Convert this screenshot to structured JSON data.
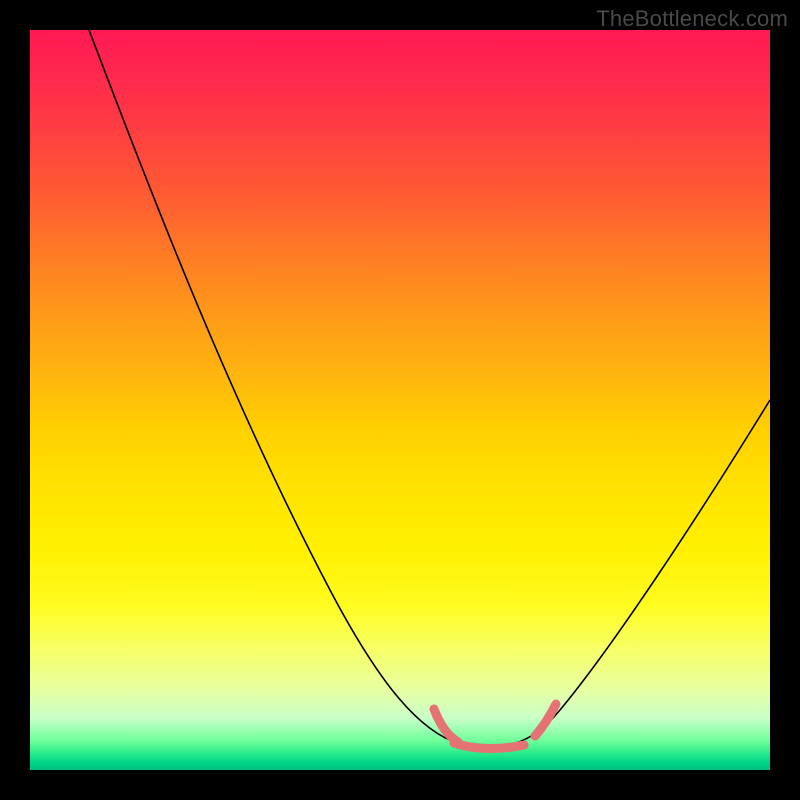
{
  "watermark": "TheBottleneck.com",
  "chart_data": {
    "type": "line",
    "title": "",
    "xlabel": "",
    "ylabel": "",
    "xlim": [
      0,
      100
    ],
    "ylim": [
      0,
      100
    ],
    "series": [
      {
        "name": "curve",
        "x": [
          8,
          12,
          16,
          20,
          24,
          28,
          32,
          36,
          40,
          44,
          48,
          52,
          55,
          58,
          61,
          64,
          67,
          70,
          73,
          76,
          80,
          84,
          88,
          92,
          96,
          100
        ],
        "y": [
          100,
          92,
          84,
          76,
          68,
          60,
          52,
          44,
          36,
          28,
          20,
          13,
          8,
          5,
          3,
          3,
          3,
          5,
          9,
          14,
          20,
          27,
          34,
          41,
          48,
          55
        ]
      }
    ],
    "highlight_segment": {
      "name": "pink fit band",
      "x_from": 54,
      "x_to": 72,
      "points": [
        {
          "x": 54,
          "y": 9
        },
        {
          "x": 57,
          "y": 6
        },
        {
          "x": 60,
          "y": 4
        },
        {
          "x": 63,
          "y": 3.5
        },
        {
          "x": 66,
          "y": 3.5
        },
        {
          "x": 69,
          "y": 5
        },
        {
          "x": 72,
          "y": 8
        }
      ]
    },
    "background": "heatmap gradient: red (top, bad) → yellow → green (bottom, good)"
  }
}
